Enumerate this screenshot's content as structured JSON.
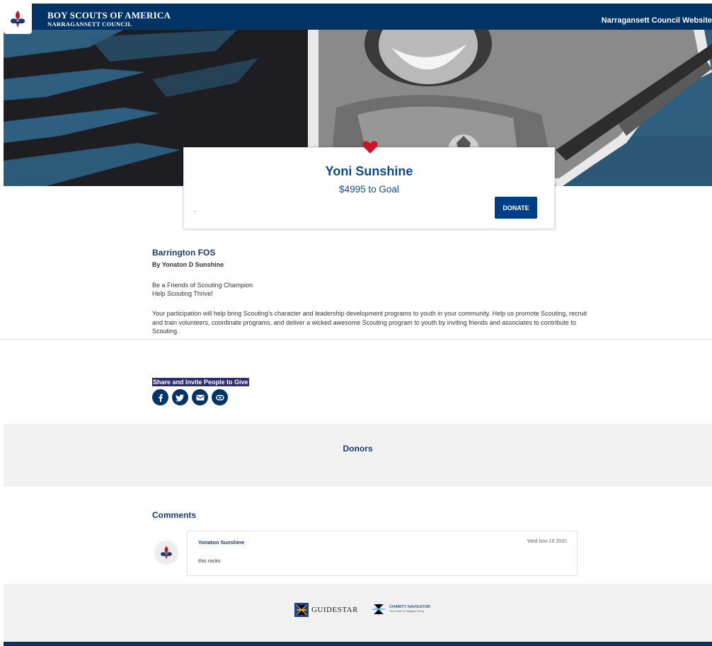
{
  "header": {
    "org_name": "BOY SCOUTS OF AMERICA",
    "council_name": "NARRAGANSETT COUNCIL",
    "website_link": "Narragansett Council Website"
  },
  "fundraiser_card": {
    "name": "Yoni Sunshine",
    "goal_text": "$4995 to Goal",
    "progress_text": ",",
    "donate_label": "DONATE"
  },
  "campaign": {
    "title": "Barrington FOS",
    "author": "By Yonaton D Sunshine",
    "tagline_1": "Be a Friends of Scouting Champion",
    "tagline_2": "Help Scouting Thrive!",
    "description": "Your participation will help bring Scouting’s character and leadership development programs to youth in your community. Help us promote Scouting, recruit and train volunteers, coordinate programs, and deliver a wicked awesome Scouting program to youth by inviting friends and associates to contribute to Scouting."
  },
  "share": {
    "label": "Share and Invite People to Give",
    "icons": [
      "facebook-icon",
      "twitter-icon",
      "email-icon",
      "link-icon"
    ]
  },
  "donors": {
    "title": "Donors"
  },
  "comments": {
    "title": "Comments",
    "items": [
      {
        "author": "Yonaton Sunshine",
        "date": "Wed Nov 18 2020",
        "text": "this rocks"
      }
    ]
  },
  "footer": {
    "guidestar_label": "GUIDESTAR",
    "charity_navigator_label": "CHARITY NAVIGATOR",
    "charity_navigator_tagline": "Your Guide To Intelligent Giving"
  },
  "colors": {
    "navy": "#003366",
    "accent_blue": "#0b4a8f",
    "heart_red": "#d0112b",
    "band_gray": "#f1f1f1"
  }
}
